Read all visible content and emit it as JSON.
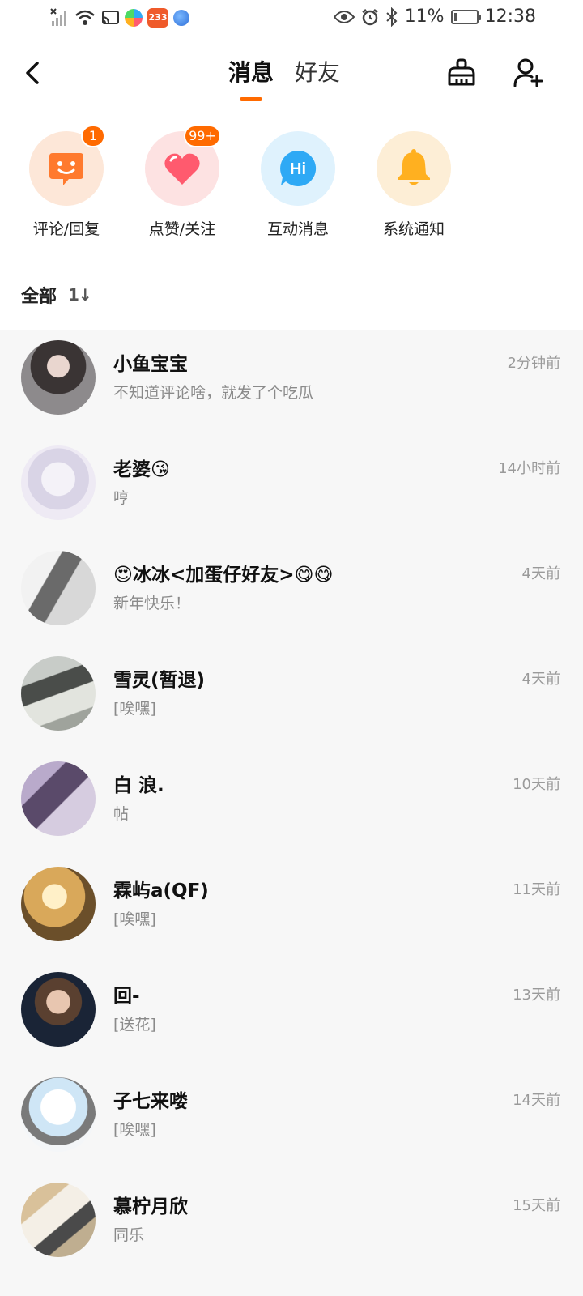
{
  "status_bar": {
    "battery": "11%",
    "time": "12:38",
    "app_badge": "233"
  },
  "header": {
    "tabs": [
      "消息",
      "好友"
    ],
    "active_tab": 0
  },
  "quick_actions": [
    {
      "label": "评论/回复",
      "badge": "1",
      "color": "#fde7d8",
      "icon_color": "#ff7a2e"
    },
    {
      "label": "点赞/关注",
      "badge": "99+",
      "color": "#fde2e2",
      "icon_color": "#ff5a6e"
    },
    {
      "label": "互动消息",
      "badge": "",
      "color": "#dff2fd",
      "icon_color": "#2ea9f5"
    },
    {
      "label": "系统通知",
      "badge": "",
      "color": "#fdeed6",
      "icon_color": "#ffb020"
    }
  ],
  "filter": {
    "label": "全部",
    "sort_label": "1↓"
  },
  "messages": [
    {
      "name": "小鱼宝宝",
      "preview": "不知道评论啥，就发了个吃瓜",
      "time": "2分钟前"
    },
    {
      "name": "老婆😘",
      "preview": "哼",
      "time": "14小时前"
    },
    {
      "name": "😍冰冰<加蛋仔好友>😋😋",
      "preview": "新年快乐！",
      "time": "4天前"
    },
    {
      "name": "雪灵(暂退)",
      "preview": "[唉嘿]",
      "time": "4天前"
    },
    {
      "name": "白 浪.",
      "preview": "帖",
      "time": "10天前"
    },
    {
      "name": "霖屿a(QF)",
      "preview": "[唉嘿]",
      "time": "11天前"
    },
    {
      "name": "回-",
      "preview": "[送花]",
      "time": "13天前"
    },
    {
      "name": "子七来喽",
      "preview": "[唉嘿]",
      "time": "14天前"
    },
    {
      "name": "慕柠月欣",
      "preview": "同乐",
      "time": "15天前"
    }
  ]
}
